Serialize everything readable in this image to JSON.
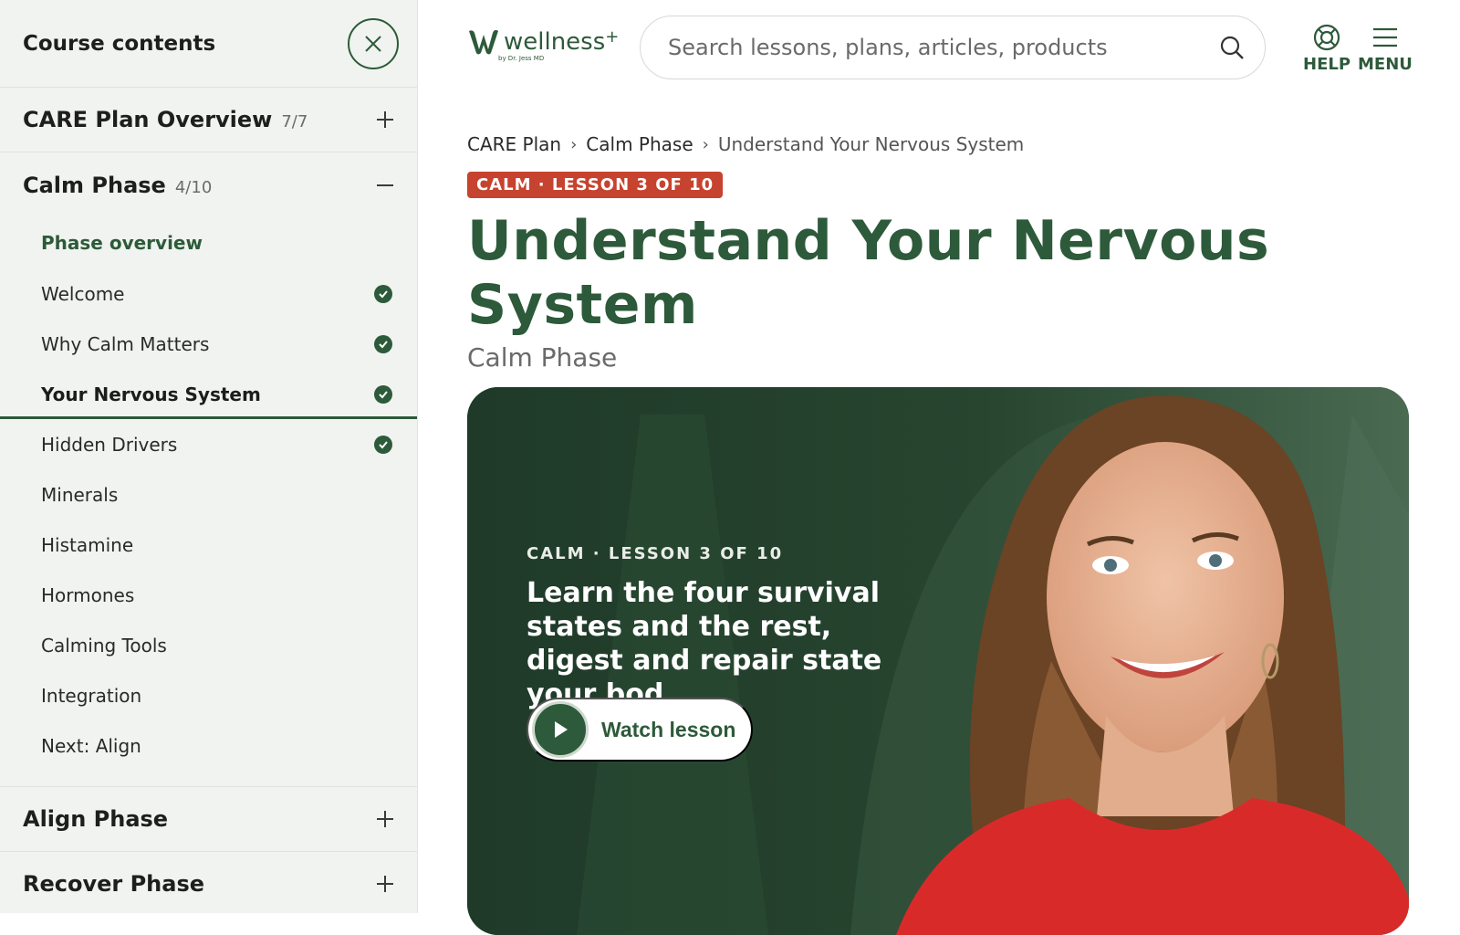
{
  "sidebar": {
    "title": "Course contents",
    "sections": [
      {
        "title": "CARE Plan Overview",
        "count": "7/7"
      },
      {
        "title": "Calm Phase",
        "count": "4/10"
      },
      {
        "title": "Align Phase"
      },
      {
        "title": "Recover Phase"
      }
    ],
    "lessons": [
      {
        "label": "Phase overview"
      },
      {
        "label": "Welcome",
        "completed": true
      },
      {
        "label": "Why Calm Matters",
        "completed": true
      },
      {
        "label": "Your Nervous System",
        "completed": true,
        "active": true
      },
      {
        "label": "Hidden Drivers",
        "completed": true
      },
      {
        "label": "Minerals"
      },
      {
        "label": "Histamine"
      },
      {
        "label": "Hormones"
      },
      {
        "label": "Calming Tools"
      },
      {
        "label": "Integration"
      },
      {
        "label": "Next: Align"
      }
    ]
  },
  "header": {
    "logo_text": "wellness",
    "logo_plus": "+",
    "logo_sub": "by Dr. Jess MD",
    "search_placeholder": "Search lessons, plans, articles, products",
    "help_label": "HELP",
    "menu_label": "MENU"
  },
  "breadcrumb": [
    "CARE Plan",
    "Calm Phase",
    "Understand Your Nervous System"
  ],
  "lesson": {
    "badge": "CALM · LESSON 3 OF 10",
    "title": "Understand Your Nervous System",
    "subtitle": "Calm Phase"
  },
  "hero": {
    "eyebrow": "CALM · LESSON 3 OF 10",
    "description": "Learn the four survival states and the rest, digest and repair state your bod…",
    "watch_label": "Watch lesson"
  },
  "colors": {
    "brand_green": "#2d5a3a",
    "badge_red": "#c6432f",
    "sidebar_bg": "#f0f3ef",
    "hero_bg": "#213c2b"
  }
}
